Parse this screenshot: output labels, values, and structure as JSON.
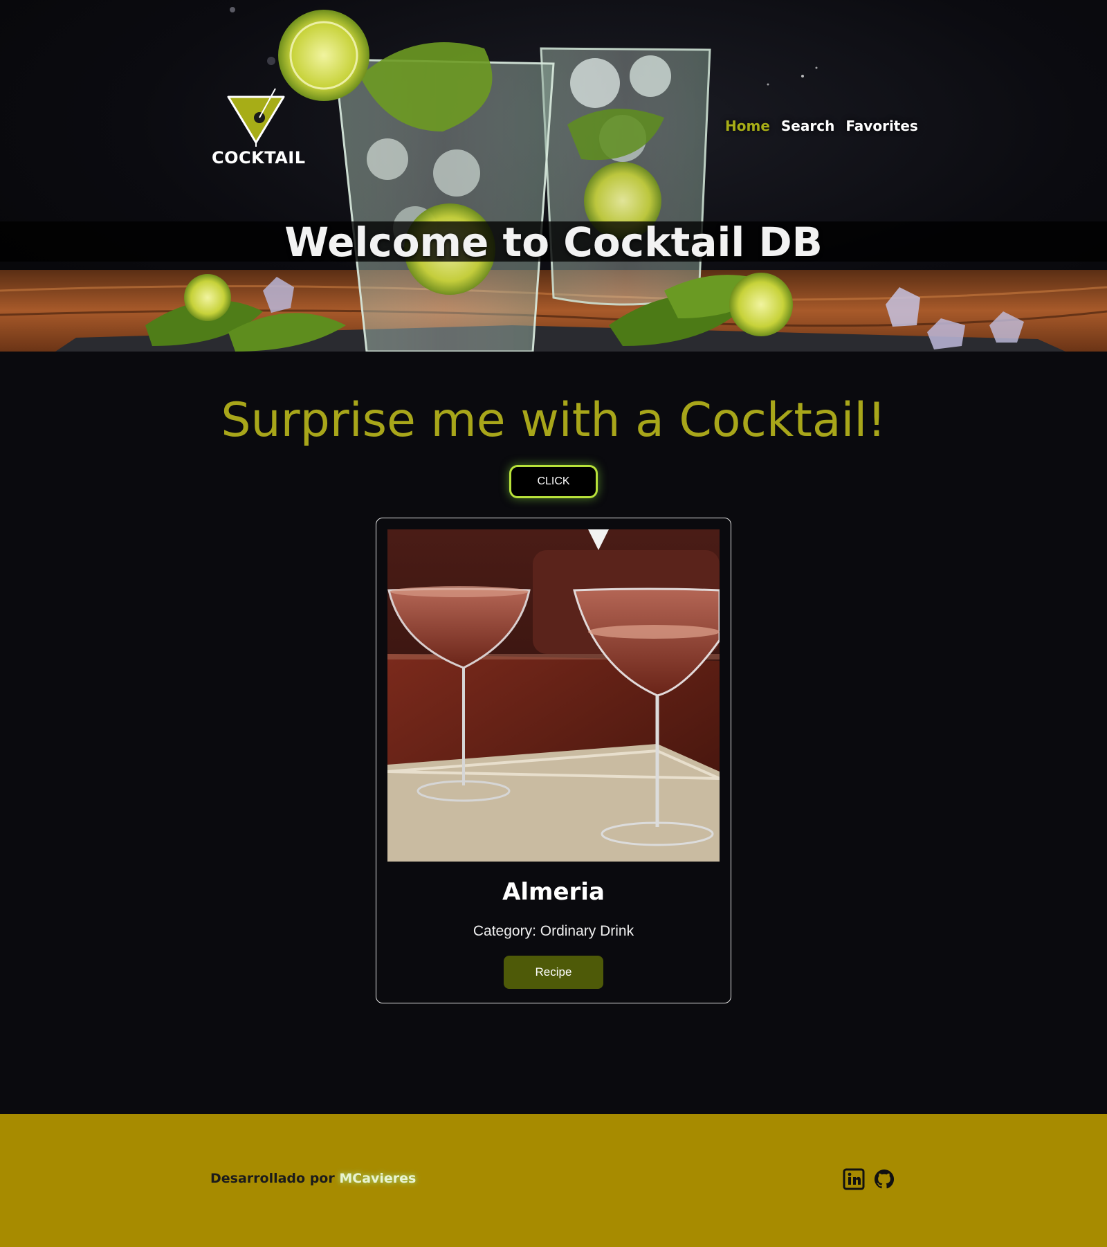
{
  "header": {
    "logo_text": "COCKTAIL",
    "nav": [
      {
        "label": "Home",
        "active": true
      },
      {
        "label": "Search",
        "active": false
      },
      {
        "label": "Favorites",
        "active": false
      }
    ],
    "welcome_title": "Welcome to Cocktail DB"
  },
  "surprise": {
    "title": "Surprise me with a Cocktail!",
    "button_label": "CLICK"
  },
  "card": {
    "name": "Almeria",
    "category": "Category: Ordinary Drink",
    "button_label": "Recipe"
  },
  "footer": {
    "credit_prefix": "Desarrollado por ",
    "author": "MCavieres",
    "social": [
      "linkedin-icon",
      "github-icon"
    ]
  },
  "colors": {
    "accent_olive": "#a7ad17",
    "footer_bg": "#a78b00",
    "recipe_btn": "#4e5a08",
    "click_border": "#b8e23a",
    "page_bg": "#0a0a0e"
  }
}
